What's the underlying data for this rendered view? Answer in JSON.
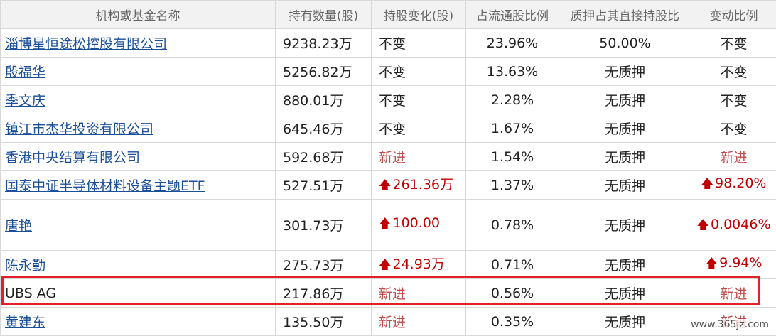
{
  "headers": {
    "name": "机构或基金名称",
    "holding": "持有数量(股)",
    "change": "持股变化(股)",
    "ratio": "占流通股比例",
    "pledge": "质押占其直接持股比",
    "vary": "变动比例"
  },
  "rows": [
    {
      "name": "淄博星恒途松控股有限公司",
      "holding": "9238.23万",
      "change": "不变",
      "change_up": false,
      "ratio": "23.96%",
      "pledge": "50.00%",
      "vary": "不变",
      "vary_up": false
    },
    {
      "name": "殷福华",
      "holding": "5256.82万",
      "change": "不变",
      "change_up": false,
      "ratio": "13.63%",
      "pledge": "无质押",
      "vary": "不变",
      "vary_up": false
    },
    {
      "name": "季文庆",
      "holding": "880.01万",
      "change": "不变",
      "change_up": false,
      "ratio": "2.28%",
      "pledge": "无质押",
      "vary": "不变",
      "vary_up": false
    },
    {
      "name": "镇江市杰华投资有限公司",
      "holding": "645.46万",
      "change": "不变",
      "change_up": false,
      "ratio": "1.67%",
      "pledge": "无质押",
      "vary": "不变",
      "vary_up": false
    },
    {
      "name": "香港中央结算有限公司",
      "holding": "592.68万",
      "change": "新进",
      "change_up": false,
      "ratio": "1.54%",
      "pledge": "无质押",
      "vary": "新进",
      "vary_up": false
    },
    {
      "name": "国泰中证半导体材料设备主题ETF",
      "holding": "527.51万",
      "change": "261.36万",
      "change_up": true,
      "ratio": "1.37%",
      "pledge": "无质押",
      "vary": "98.20%",
      "vary_up": true
    },
    {
      "name": "唐艳",
      "holding": "301.73万",
      "change": "100.00",
      "change_up": true,
      "ratio": "0.78%",
      "pledge": "无质押",
      "vary": "0.0046%",
      "vary_up": true
    },
    {
      "name": "陈永勤",
      "holding": "275.73万",
      "change": "24.93万",
      "change_up": true,
      "ratio": "0.71%",
      "pledge": "无质押",
      "vary": "9.94%",
      "vary_up": true
    },
    {
      "name": "UBS AG",
      "holding": "217.86万",
      "change": "新进",
      "change_up": false,
      "ratio": "0.56%",
      "pledge": "无质押",
      "vary": "新进",
      "vary_up": false
    },
    {
      "name": "黄建东",
      "holding": "135.50万",
      "change": "新进",
      "change_up": false,
      "ratio": "0.35%",
      "pledge": "无质押",
      "vary": "新进",
      "vary_up": false
    }
  ],
  "watermark": "www.365jz.com",
  "colors": {
    "link": "#1a4f99",
    "up": "#c00000",
    "highlight": "#e32027"
  }
}
